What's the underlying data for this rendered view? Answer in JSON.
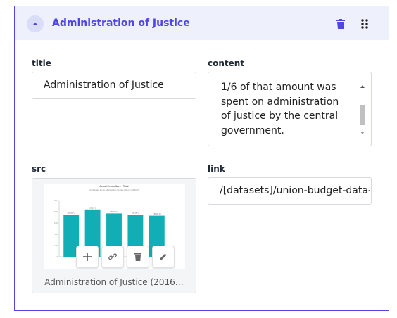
{
  "header": {
    "title": "Administration of Justice",
    "collapse_icon": "chevron-up-icon",
    "delete_icon": "trash-icon",
    "drag_icon": "drag-handle-icon",
    "accent_color": "#4f46e5"
  },
  "fields": {
    "title": {
      "label": "title",
      "value": "Administration of Justice"
    },
    "content": {
      "label": "content",
      "value": "1/6 of that amount was spent on administration of justice by the central government."
    },
    "src": {
      "label": "src",
      "caption": "Administration of Justice (2016…"
    },
    "link": {
      "label": "link",
      "value": "/[datasets]/union-budget-data-l"
    }
  },
  "image_actions": [
    "plus-icon",
    "link-icon",
    "trash-icon",
    "pencil-icon"
  ],
  "chart_data": {
    "type": "bar",
    "title": "Actual Expenditure - Total",
    "subtitle": "Union budget line for Administration of Justice 2016-17 to 2020-21",
    "bar_color": "#12aeb5",
    "categories": [
      "",
      "",
      "",
      "",
      ""
    ],
    "values": [
      750,
      840,
      770,
      750,
      730
    ],
    "data_labels": [
      "750.00 Cr",
      "839.00 Cr",
      "770.00 Cr",
      "750.00 Cr",
      "730.00 Cr"
    ],
    "y_ticks": [
      "0",
      "200",
      "400",
      "600",
      "800",
      "1,000"
    ],
    "ylim": [
      0,
      1000
    ]
  }
}
